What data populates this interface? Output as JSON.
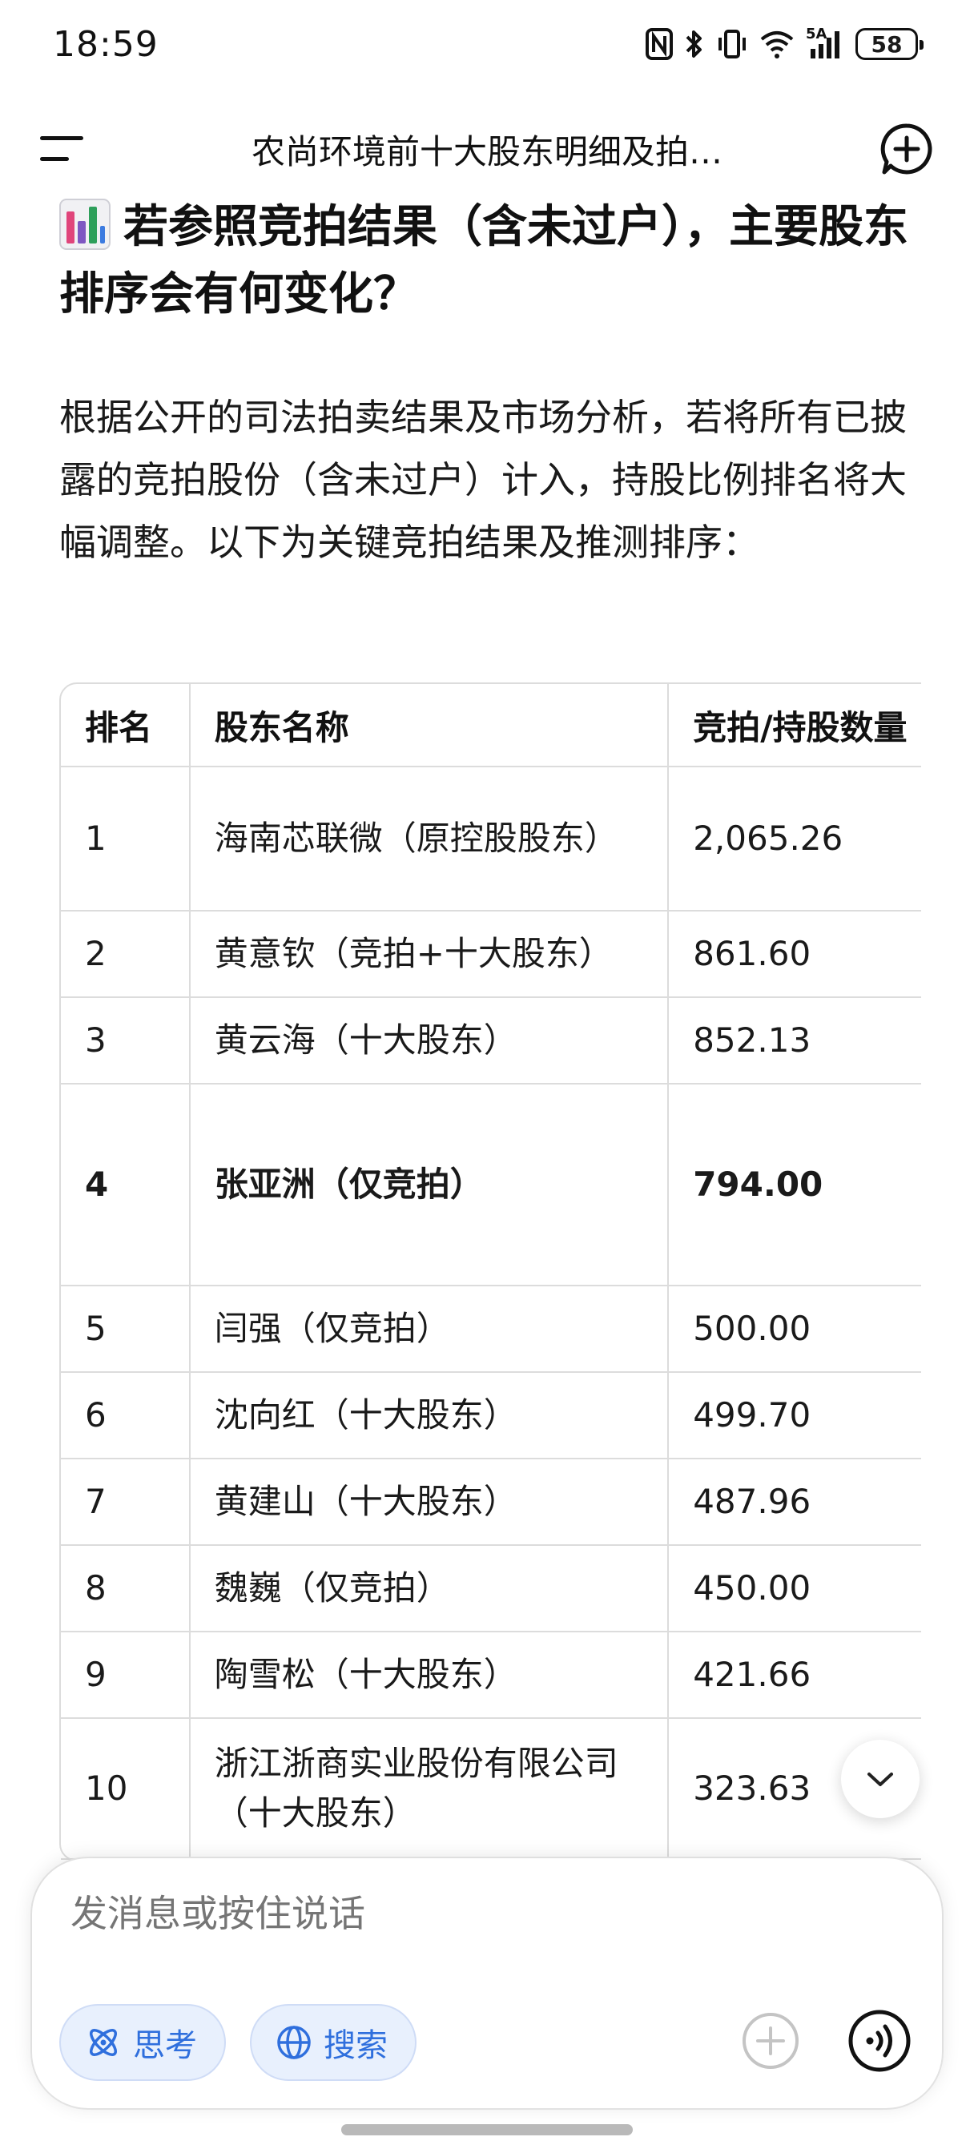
{
  "status_bar": {
    "time": "18:59",
    "network": "5A",
    "battery": "58",
    "icons": [
      "nfc-icon",
      "bluetooth-icon",
      "vibrate-icon",
      "wifi-icon",
      "cellular-signal-icon",
      "battery-icon"
    ]
  },
  "header": {
    "title": "农尚环境前十大股东明细及拍…",
    "menu_icon": "menu-icon",
    "new_chat_icon": "new-chat-icon"
  },
  "content": {
    "heading_icon": "bar-chart-emoji",
    "heading": "若参照竞拍结果（含未过户），主要股东排序会有何变化？",
    "paragraph": "根据公开的司法拍卖结果及市场分析，若将所有已披露的竞拍股份（含未过户）计入，持股比例排名将大幅调整。以下为关键竞拍结果及推测排序："
  },
  "table": {
    "headers": [
      "排名",
      "股东名称",
      "竞拍/持股数量"
    ],
    "rows": [
      {
        "rank": "1",
        "name": "海南芯联微（原控股股东）",
        "qty": "2,065.26"
      },
      {
        "rank": "2",
        "name": "黄意钦（竞拍+十大股东）",
        "qty": "861.60"
      },
      {
        "rank": "3",
        "name": "黄云海（十大股东）",
        "qty": "852.13"
      },
      {
        "rank": "4",
        "name": "张亚洲（仅竞拍）",
        "qty": "794.00"
      },
      {
        "rank": "5",
        "name": "闫强（仅竞拍）",
        "qty": "500.00"
      },
      {
        "rank": "6",
        "name": "沈向红（十大股东）",
        "qty": "499.70"
      },
      {
        "rank": "7",
        "name": "黄建山（十大股东）",
        "qty": "487.96"
      },
      {
        "rank": "8",
        "name": "魏巍（仅竞拍）",
        "qty": "450.00"
      },
      {
        "rank": "9",
        "name": "陶雪松（十大股东）",
        "qty": "421.66"
      },
      {
        "rank": "10",
        "name": "浙江浙商实业股份有限公司（十大股东）",
        "qty": "323.63"
      }
    ]
  },
  "composer": {
    "placeholder": "发消息或按住说话",
    "think_label": "思考",
    "search_label": "搜索",
    "accent_color": "#2f6fdd"
  }
}
